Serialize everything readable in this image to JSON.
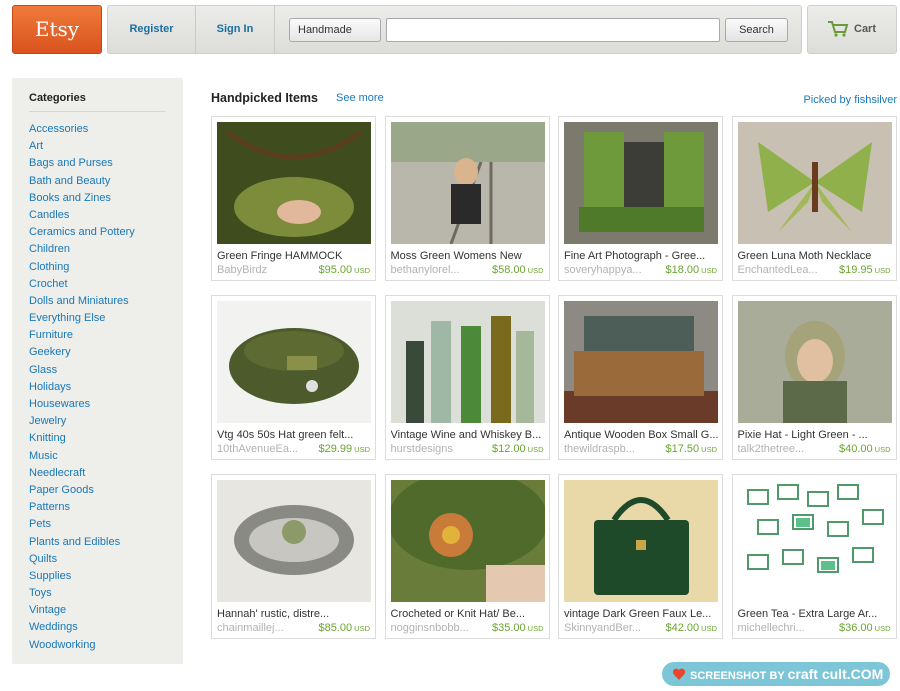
{
  "header": {
    "logo": "Etsy",
    "register": "Register",
    "sign_in": "Sign In",
    "shop_type": "Handmade",
    "search_value": "",
    "search_button": "Search",
    "cart": "Cart"
  },
  "sidebar": {
    "title": "Categories",
    "items": [
      "Accessories",
      "Art",
      "Bags and Purses",
      "Bath and Beauty",
      "Books and Zines",
      "Candles",
      "Ceramics and Pottery",
      "Children",
      "Clothing",
      "Crochet",
      "Dolls and Miniatures",
      "Everything Else",
      "Furniture",
      "Geekery",
      "Glass",
      "Holidays",
      "Housewares",
      "Jewelry",
      "Knitting",
      "Music",
      "Needlecraft",
      "Paper Goods",
      "Patterns",
      "Pets",
      "Plants and Edibles",
      "Quilts",
      "Supplies",
      "Toys",
      "Vintage",
      "Weddings",
      "Woodworking"
    ]
  },
  "main": {
    "title": "Handpicked Items",
    "see_more": "See more",
    "picked_by": "Picked by fishsilver",
    "currency": "USD",
    "items": [
      {
        "title": "Green Fringe HAMMOCK",
        "shop": "BabyBirdz",
        "price": "$95.00"
      },
      {
        "title": "Moss Green Womens New",
        "shop": "bethanylorel...",
        "price": "$58.00"
      },
      {
        "title": "Fine Art Photograph - Gree...",
        "shop": "soveryhappya...",
        "price": "$18.00"
      },
      {
        "title": "Green Luna Moth Necklace",
        "shop": "EnchantedLea...",
        "price": "$19.95"
      },
      {
        "title": "Vtg 40s 50s Hat green felt...",
        "shop": "10thAvenueEa...",
        "price": "$29.99"
      },
      {
        "title": "Vintage Wine and Whiskey B...",
        "shop": "hurstdesigns",
        "price": "$12.00"
      },
      {
        "title": "Antique Wooden Box Small G...",
        "shop": "thewildraspb...",
        "price": "$17.50"
      },
      {
        "title": "Pixie Hat - Light Green - ...",
        "shop": "talk2thetree...",
        "price": "$40.00"
      },
      {
        "title": "Hannah' rustic, distre...",
        "shop": "chainmaillej...",
        "price": "$85.00"
      },
      {
        "title": "Crocheted or Knit Hat/ Be...",
        "shop": "nogginsnbobb...",
        "price": "$35.00"
      },
      {
        "title": "vintage Dark Green Faux Le...",
        "shop": "SkinnyandBer...",
        "price": "$42.00"
      },
      {
        "title": "Green Tea - Extra Large Ar...",
        "shop": "michellechri...",
        "price": "$36.00"
      }
    ]
  },
  "watermark": {
    "prefix": "SCREENSHOT BY",
    "brand": "craft cult.COM"
  },
  "colors": {
    "etsy_orange": "#e0622a",
    "link_blue": "#1a78b8",
    "price_green": "#6ba531"
  }
}
